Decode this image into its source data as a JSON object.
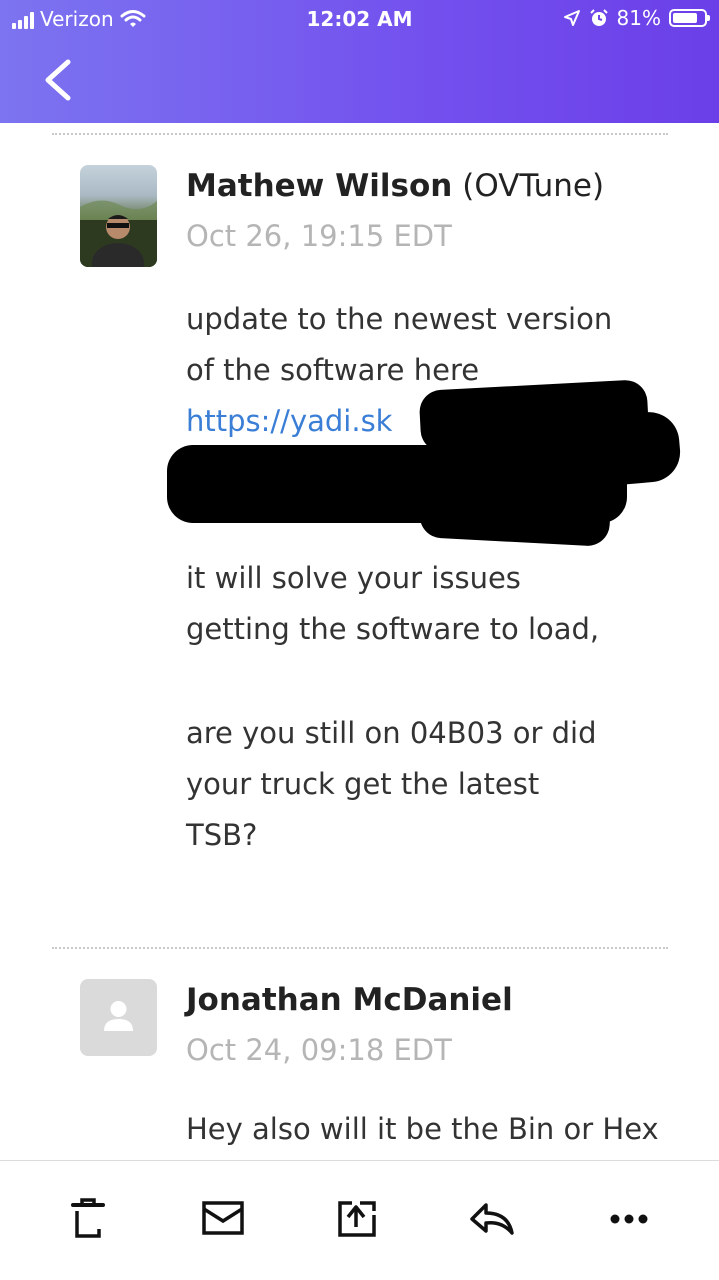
{
  "status_bar": {
    "carrier": "Verizon",
    "time": "12:02 AM",
    "battery_percent": "81%",
    "battery_level": 0.81
  },
  "header": {
    "back_icon": "chevron-left-icon",
    "accent_color": "#7350ee"
  },
  "messages": [
    {
      "sender_name": "Mathew Wilson",
      "sender_org": "(OVTune)",
      "date": "Oct 26, 19:15 EDT",
      "lines": [
        "update to the newest version",
        "of the software here",
        "https://yadi.sk",
        "it will solve your issues",
        "getting the software to load,",
        "are you still on 04B03 or did",
        "your truck get the latest",
        "TSB?"
      ]
    },
    {
      "sender_name": "Jonathan McDaniel",
      "date": "Oct 24, 09:18 EDT",
      "lines": [
        "Hey also will it be the Bin or Hex"
      ]
    }
  ],
  "toolbar": {
    "icons": [
      "trash-icon",
      "archive-icon",
      "move-icon",
      "reply-icon",
      "more-icon"
    ]
  }
}
